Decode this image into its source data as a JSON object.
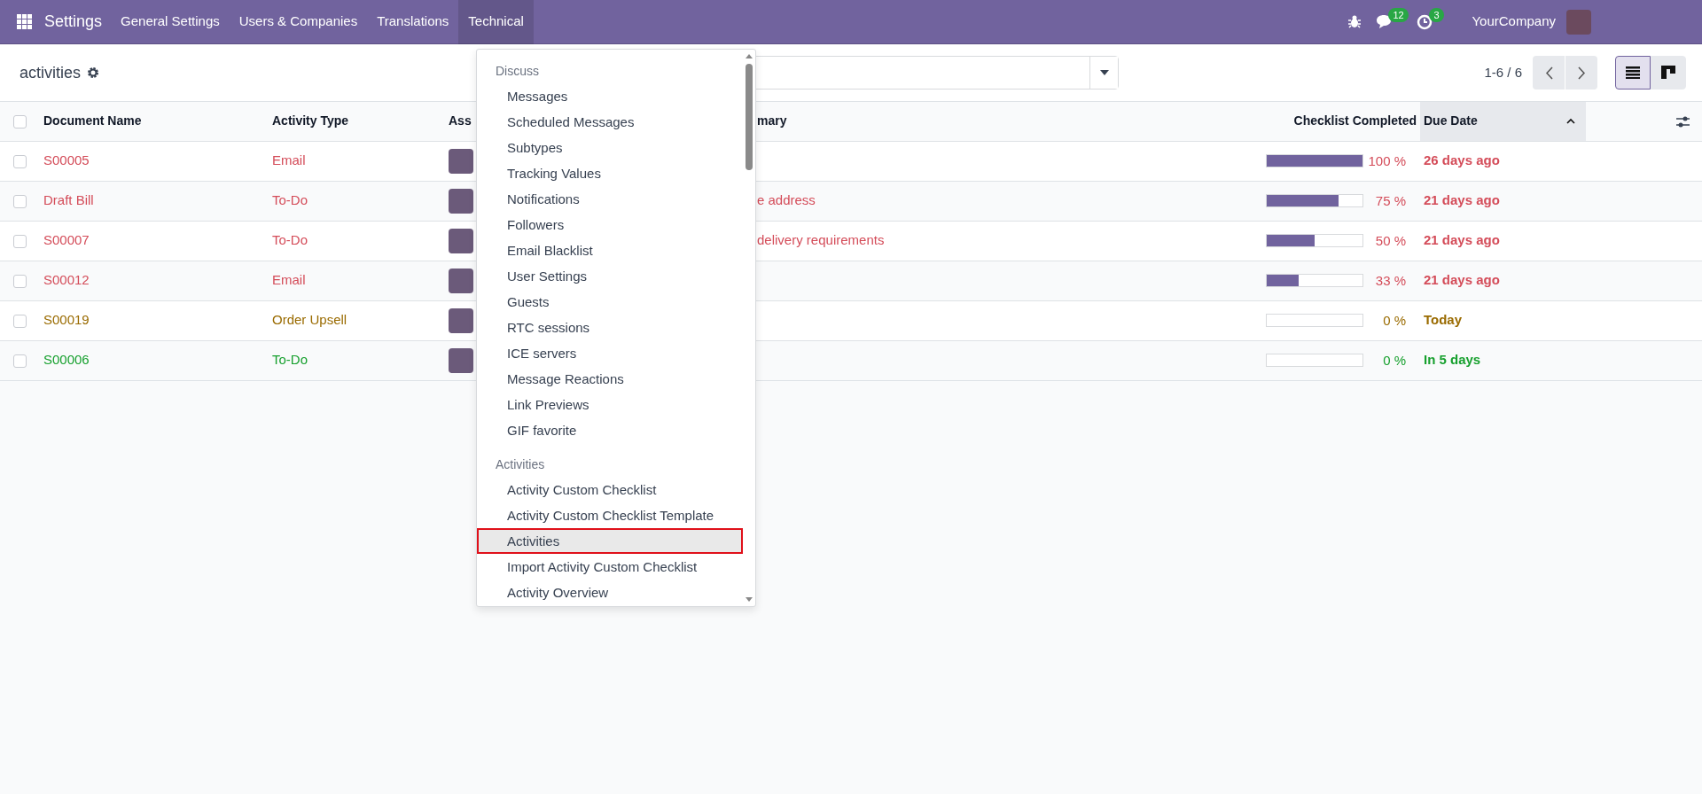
{
  "navbar": {
    "app_name": "Settings",
    "menus": [
      {
        "label": "General Settings",
        "selected": false
      },
      {
        "label": "Users & Companies",
        "selected": false
      },
      {
        "label": "Translations",
        "selected": false
      },
      {
        "label": "Technical",
        "selected": true
      }
    ],
    "systray": {
      "messages_count": "12",
      "activities_count": "3",
      "company": "YourCompany"
    }
  },
  "control_panel": {
    "title": "activities",
    "pager": "1-6 / 6",
    "views": [
      {
        "kind": "list",
        "selected": true
      },
      {
        "kind": "kanban",
        "selected": false
      }
    ]
  },
  "table": {
    "header_checked": false,
    "columns": [
      {
        "label": "Document Name",
        "sorted": false
      },
      {
        "label": "Activity Type",
        "sorted": false
      },
      {
        "label": "Ass",
        "sorted": false
      },
      {
        "label": "mary",
        "sorted": false
      },
      {
        "label": "Checklist Completed",
        "sorted": false
      },
      {
        "label": "Due Date",
        "sorted": true
      }
    ],
    "rows": [
      {
        "checked": false,
        "document": "S00005",
        "activity_type": "Email",
        "summary": "",
        "level": 1,
        "percent": "100 %",
        "due": "26 days ago",
        "color": "#d44c59"
      },
      {
        "checked": false,
        "document": "Draft Bill",
        "activity_type": "To-Do",
        "summary": "e address",
        "level": 0.75,
        "percent": "75 %",
        "due": "21 days ago",
        "color": "#d44c59"
      },
      {
        "checked": false,
        "document": "S00007",
        "activity_type": "To-Do",
        "summary": "delivery requirements",
        "level": 0.5,
        "percent": "50 %",
        "due": "21 days ago",
        "color": "#d44c59"
      },
      {
        "checked": false,
        "document": "S00012",
        "activity_type": "Email",
        "summary": "",
        "level": 0.33,
        "percent": "33 %",
        "due": "21 days ago",
        "color": "#d44c59"
      },
      {
        "checked": false,
        "document": "S00019",
        "activity_type": "Order Upsell",
        "summary": "",
        "level": 0,
        "percent": "0 %",
        "due": "Today",
        "color": "#9a6b01"
      },
      {
        "checked": false,
        "document": "S00006",
        "activity_type": "To-Do",
        "summary": "",
        "level": 0,
        "percent": "0 %",
        "due": "In 5 days",
        "color": "#17a02e"
      }
    ]
  },
  "dropdown": {
    "sections": [
      {
        "title": "Discuss",
        "items": [
          {
            "label": "Messages",
            "selected": false
          },
          {
            "label": "Scheduled Messages",
            "selected": false
          },
          {
            "label": "Subtypes",
            "selected": false
          },
          {
            "label": "Tracking Values",
            "selected": false
          },
          {
            "label": "Notifications",
            "selected": false
          },
          {
            "label": "Followers",
            "selected": false
          },
          {
            "label": "Email Blacklist",
            "selected": false
          },
          {
            "label": "User Settings",
            "selected": false
          },
          {
            "label": "Guests",
            "selected": false
          },
          {
            "label": "RTC sessions",
            "selected": false
          },
          {
            "label": "ICE servers",
            "selected": false
          },
          {
            "label": "Message Reactions",
            "selected": false
          },
          {
            "label": "Link Previews",
            "selected": false
          },
          {
            "label": "GIF favorite",
            "selected": false
          }
        ]
      },
      {
        "title": "Activities",
        "items": [
          {
            "label": "Activity Custom Checklist",
            "selected": false
          },
          {
            "label": "Activity Custom Checklist Template",
            "selected": false
          },
          {
            "label": "Activities",
            "selected": true
          },
          {
            "label": "Import Activity Custom Checklist",
            "selected": false
          },
          {
            "label": "Activity Overview",
            "selected": false
          }
        ]
      }
    ]
  }
}
